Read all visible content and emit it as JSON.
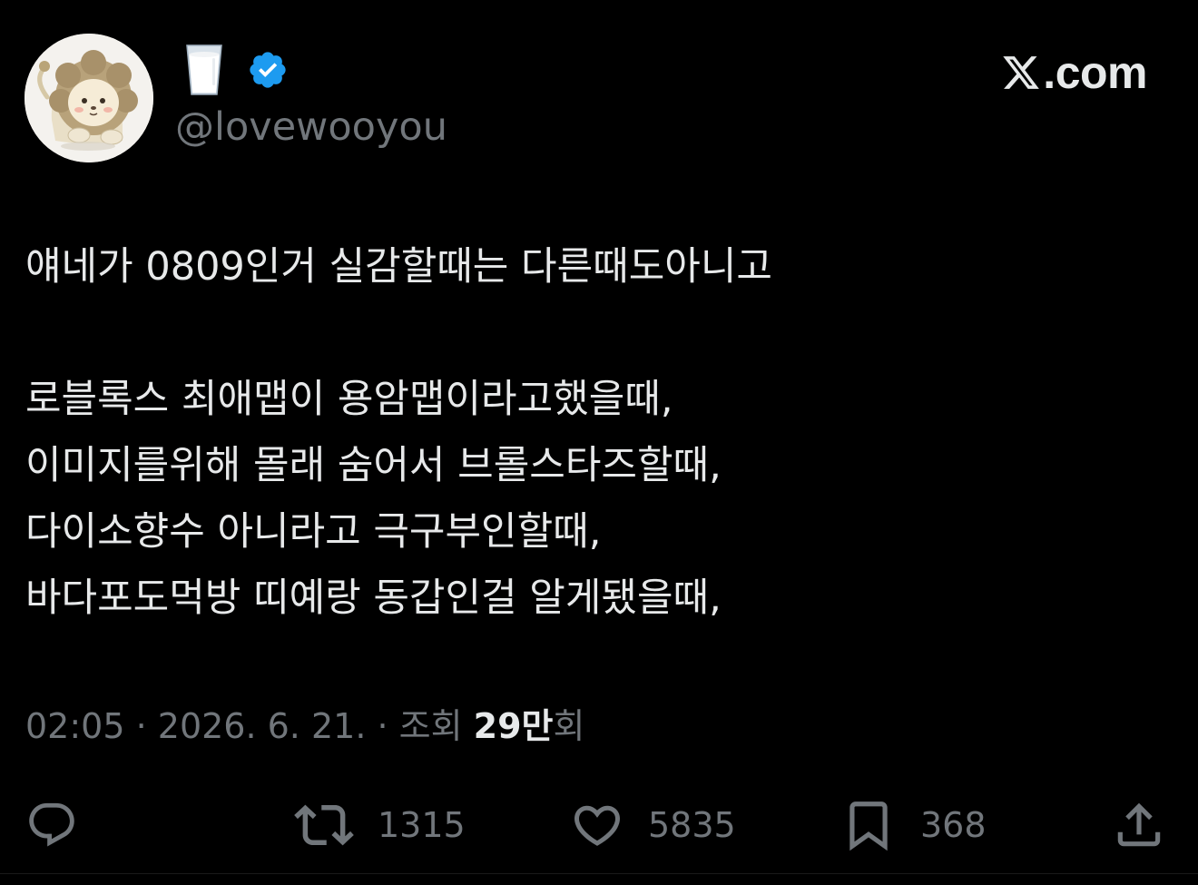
{
  "header": {
    "avatar_icon": "lion-avatar-icon",
    "display_name_icon": "milk-glass-icon",
    "verified_icon": "verified-badge-icon",
    "verified_color": "#1d9bf0",
    "handle": "@lovewooyou"
  },
  "brand": {
    "icon": "x-logo-icon",
    "text": ".com"
  },
  "tweet": {
    "lines": [
      "얘네가 0809인거 실감할때는 다른때도아니고",
      "로블록스 최애맵이 용암맵이라고했을때,",
      "이미지를위해 몰래 숨어서 브롤스타즈할때,",
      "다이소향수 아니라고 극구부인할때,",
      "바다포도먹방 띠예랑 동갑인걸 알게됐을때,"
    ]
  },
  "meta": {
    "time": "02:05",
    "sep1": " · ",
    "date": "2026. 6. 21.",
    "sep2": " · ",
    "views_prefix": "조회 ",
    "views_count": "29만",
    "views_suffix": "회"
  },
  "actions": {
    "reply": {
      "icon": "reply-icon"
    },
    "retweet": {
      "icon": "retweet-icon",
      "count": "1315"
    },
    "like": {
      "icon": "heart-icon",
      "count": "5835"
    },
    "bookmark": {
      "icon": "bookmark-icon",
      "count": "368"
    },
    "share": {
      "icon": "share-icon"
    }
  },
  "colors": {
    "background": "#000000",
    "text_primary": "#e7e9ea",
    "text_secondary": "#71767b"
  }
}
